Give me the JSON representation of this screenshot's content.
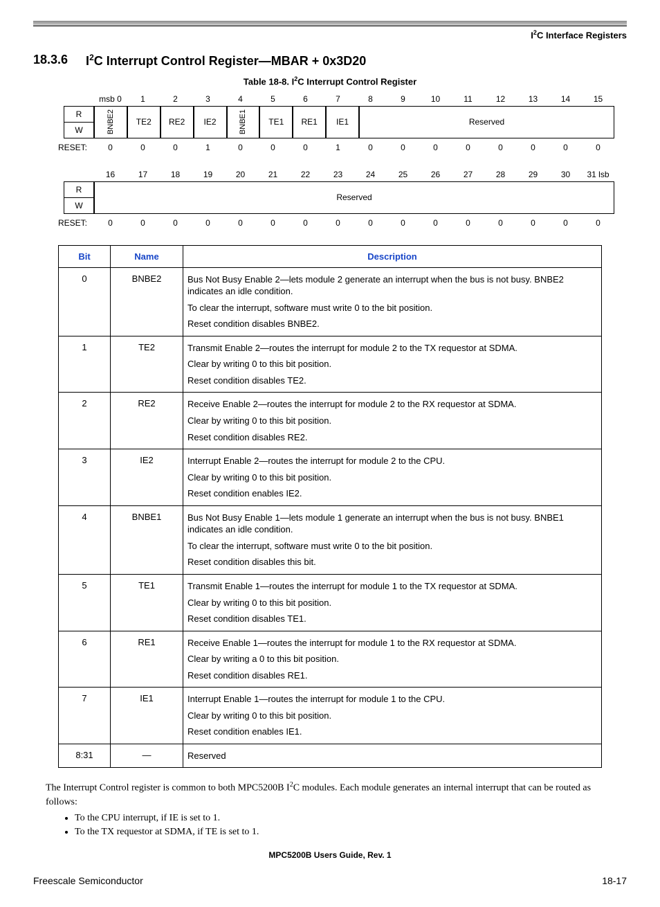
{
  "running_head": "I²C Interface Registers",
  "section_number": "18.3.6",
  "section_title": "I²C Interrupt Control Register—MBAR + 0x3D20",
  "table_caption": "Table 18-8. I²C Interrupt Control Register",
  "reg1": {
    "bits": [
      "msb 0",
      "1",
      "2",
      "3",
      "4",
      "5",
      "6",
      "7",
      "8",
      "9",
      "10",
      "11",
      "12",
      "13",
      "14",
      "15"
    ],
    "r": "R",
    "w": "W",
    "fields": [
      {
        "span": 1,
        "label": "BNBE2",
        "vert": true
      },
      {
        "span": 1,
        "label": "TE2"
      },
      {
        "span": 1,
        "label": "RE2"
      },
      {
        "span": 1,
        "label": "IE2"
      },
      {
        "span": 1,
        "label": "BNBE1",
        "vert": true
      },
      {
        "span": 1,
        "label": "TE1"
      },
      {
        "span": 1,
        "label": "RE1"
      },
      {
        "span": 1,
        "label": "IE1"
      },
      {
        "span": 8,
        "label": "Reserved"
      }
    ],
    "reset_label": "RESET:",
    "reset": [
      "0",
      "0",
      "0",
      "1",
      "0",
      "0",
      "0",
      "1",
      "0",
      "0",
      "0",
      "0",
      "0",
      "0",
      "0",
      "0"
    ]
  },
  "reg2": {
    "bits": [
      "16",
      "17",
      "18",
      "19",
      "20",
      "21",
      "22",
      "23",
      "24",
      "25",
      "26",
      "27",
      "28",
      "29",
      "30",
      "31 lsb"
    ],
    "r": "R",
    "w": "W",
    "fields": [
      {
        "span": 16,
        "label": "Reserved"
      }
    ],
    "reset_label": "RESET:",
    "reset": [
      "0",
      "0",
      "0",
      "0",
      "0",
      "0",
      "0",
      "0",
      "0",
      "0",
      "0",
      "0",
      "0",
      "0",
      "0",
      "0"
    ]
  },
  "desc_headers": {
    "bit": "Bit",
    "name": "Name",
    "description": "Description"
  },
  "desc_rows": [
    {
      "bit": "0",
      "name": "BNBE2",
      "desc": [
        "Bus Not Busy Enable 2—lets module 2 generate an interrupt when the bus is not busy. BNBE2 indicates an idle condition.",
        "To clear the interrupt, software must write 0 to the bit position.",
        "Reset condition disables BNBE2."
      ]
    },
    {
      "bit": "1",
      "name": "TE2",
      "desc": [
        "Transmit Enable 2—routes the interrupt for module 2 to the TX requestor at SDMA.",
        "Clear by writing 0 to this bit position.",
        "Reset condition disables TE2."
      ]
    },
    {
      "bit": "2",
      "name": "RE2",
      "desc": [
        "Receive Enable 2—routes the interrupt for module 2 to the RX requestor at SDMA.",
        "Clear by writing 0 to this bit position.",
        "Reset condition disables RE2."
      ]
    },
    {
      "bit": "3",
      "name": "IE2",
      "desc": [
        "Interrupt Enable 2—routes the interrupt for module 2 to the CPU.",
        "Clear by writing 0 to this bit position.",
        "Reset condition enables IE2."
      ]
    },
    {
      "bit": "4",
      "name": "BNBE1",
      "desc": [
        "Bus Not Busy Enable 1—lets module 1 generate an interrupt when the bus is not busy. BNBE1 indicates an idle condition.",
        "To clear the interrupt, software must write 0 to the bit position.",
        "Reset condition disables this bit."
      ]
    },
    {
      "bit": "5",
      "name": "TE1",
      "desc": [
        "Transmit Enable 1—routes the interrupt for module 1 to the TX requestor at SDMA.",
        "Clear by writing 0 to this bit position.",
        "Reset condition disables TE1."
      ]
    },
    {
      "bit": "6",
      "name": "RE1",
      "desc": [
        "Receive Enable 1—routes the interrupt for module 1 to the RX requestor at SDMA.",
        "Clear by writing a 0 to this bit position.",
        "Reset condition disables RE1."
      ]
    },
    {
      "bit": "7",
      "name": "IE1",
      "desc": [
        "Interrupt Enable 1—routes the interrupt for module 1 to the CPU.",
        "Clear by writing 0 to this bit position.",
        "Reset condition enables IE1."
      ]
    },
    {
      "bit": "8:31",
      "name": "—",
      "desc": [
        "Reserved"
      ]
    }
  ],
  "body_text": "The Interrupt Control register is common to both MPC5200B I²C modules. Each module generates an internal interrupt that can be routed as follows:",
  "bullets": [
    "To the CPU interrupt, if IE is set to 1.",
    "To the TX requestor at SDMA, if TE is set to 1."
  ],
  "footer_guide": "MPC5200B Users Guide, Rev. 1",
  "footer_left": "Freescale Semiconductor",
  "footer_right": "18-17",
  "chart_data": {
    "type": "table",
    "register": "I2C Interrupt Control Register",
    "address": "MBAR + 0x3D20",
    "bits": [
      {
        "bit": 0,
        "name": "BNBE2",
        "reset": 0
      },
      {
        "bit": 1,
        "name": "TE2",
        "reset": 0
      },
      {
        "bit": 2,
        "name": "RE2",
        "reset": 0
      },
      {
        "bit": 3,
        "name": "IE2",
        "reset": 1
      },
      {
        "bit": 4,
        "name": "BNBE1",
        "reset": 0
      },
      {
        "bit": 5,
        "name": "TE1",
        "reset": 0
      },
      {
        "bit": 6,
        "name": "RE1",
        "reset": 0
      },
      {
        "bit": 7,
        "name": "IE1",
        "reset": 1
      },
      {
        "bit": "8:31",
        "name": "Reserved",
        "reset": 0
      }
    ]
  }
}
